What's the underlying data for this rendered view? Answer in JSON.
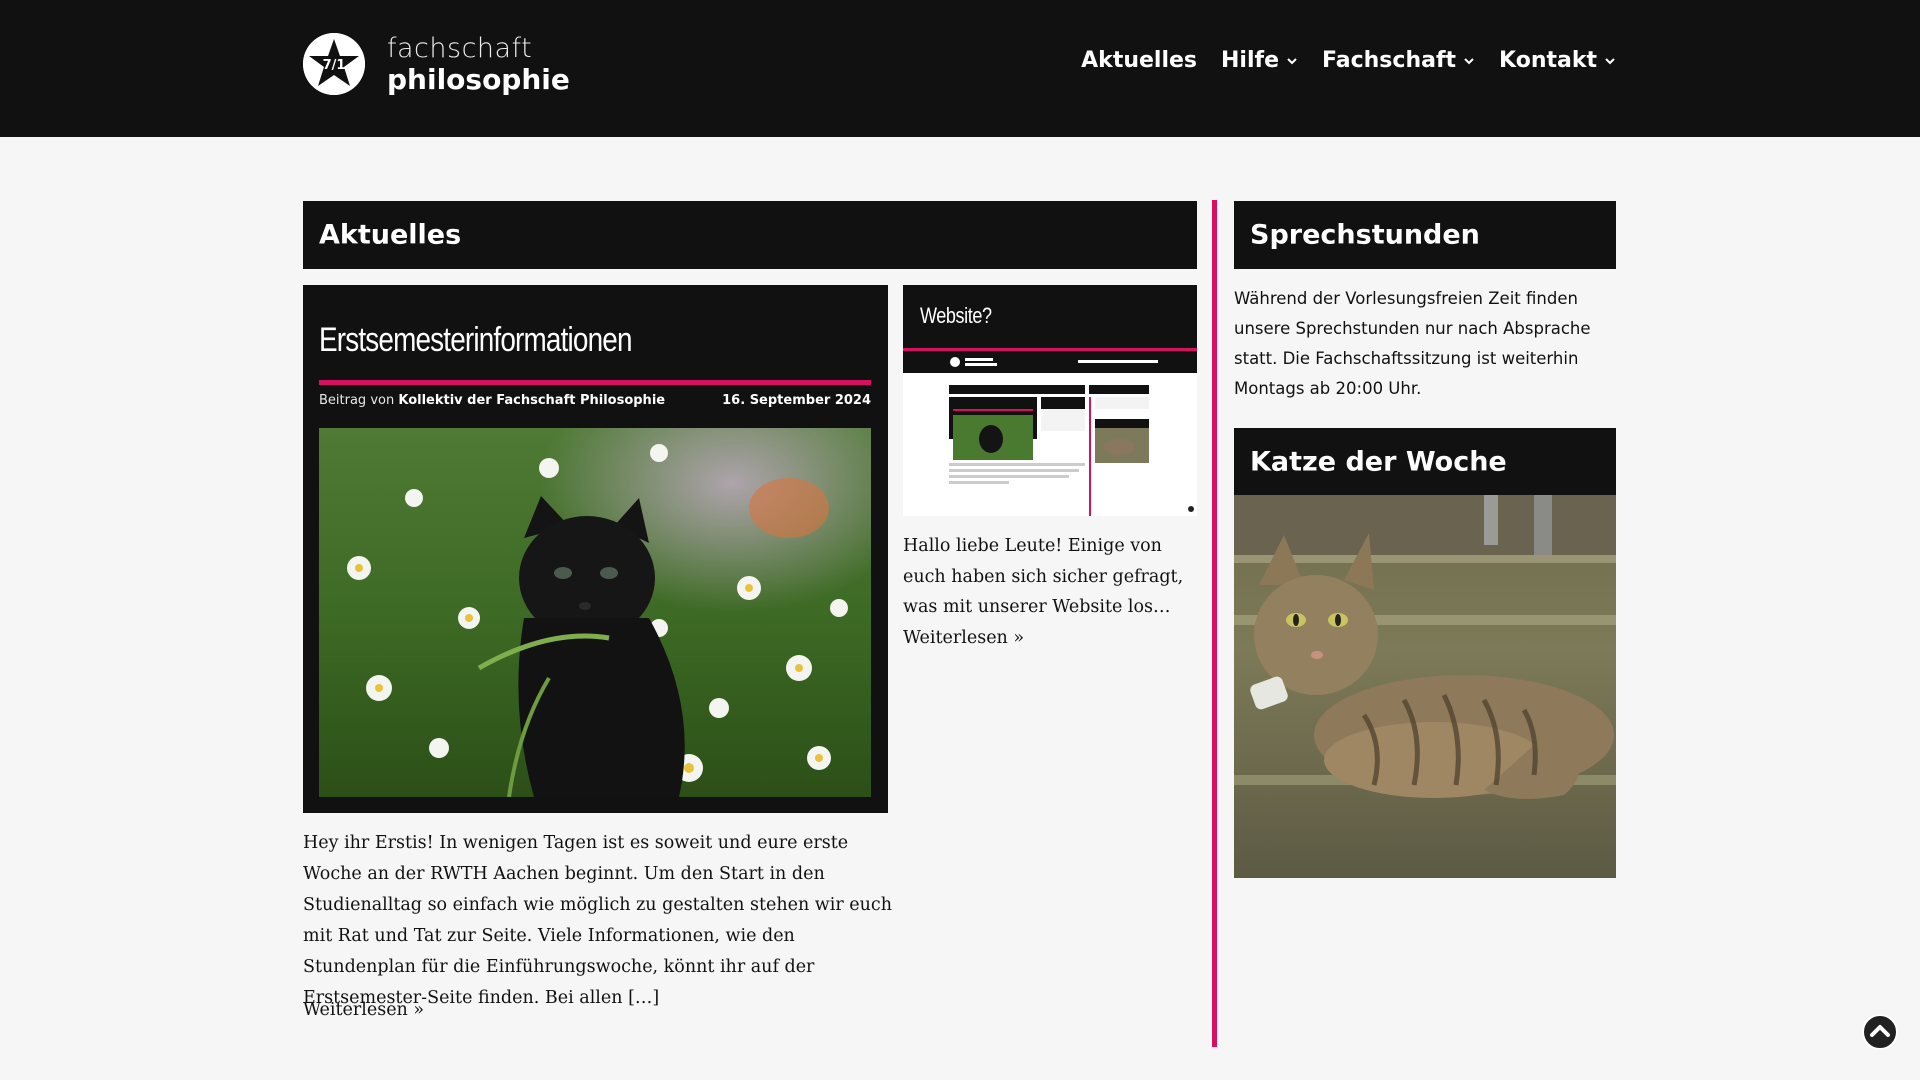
{
  "header": {
    "logo_top": "fachschaft",
    "logo_bottom": "philosophie",
    "logo_mark": "7/1",
    "nav": [
      {
        "label": "Aktuelles",
        "has_dropdown": false
      },
      {
        "label": "Hilfe",
        "has_dropdown": true
      },
      {
        "label": "Fachschaft",
        "has_dropdown": true
      },
      {
        "label": "Kontakt",
        "has_dropdown": true
      }
    ]
  },
  "main": {
    "section_title": "Aktuelles",
    "featured_post": {
      "title": "Erstsemesterinformationen",
      "by_prefix": "Beitrag von",
      "author": "Kollektiv der Fachschaft Philosophie",
      "date": "16. September 2024",
      "excerpt": "Hey ihr Erstis! In wenigen Tagen ist es soweit und eure erste Woche an der RWTH Aachen beginnt. Um den Start in den Studienalltag so einfach wie möglich zu gestalten stehen wir euch mit Rat und Tat zur Seite. Viele Informationen, wie den Stundenplan für die Einführungswoche, könnt ihr auf der Erstsemester-Seite finden. Bei allen […]",
      "read_more": "Weiterlesen »"
    },
    "second_post": {
      "title": "Website?",
      "excerpt": "Hallo liebe Leute! Einige von euch haben sich sicher gefragt, was mit unserer Website los… Weiterlesen »"
    }
  },
  "sidebar": {
    "office_hours_title": "Sprechstunden",
    "office_hours_text": "Während der Vorlesungsfreien Zeit finden unsere Sprechstunden nur nach Absprache statt. Die Fachschaftssitzung ist weiterhin Montags ab 20:00 Uhr.",
    "cat_title": "Katze der Woche"
  },
  "colors": {
    "accent": "#d6115f",
    "header_bg": "#111111",
    "page_bg": "#f6f6f6"
  },
  "icons": {
    "dropdown": "chevron-down-icon",
    "scroll_top": "chevron-up-icon",
    "logo": "star-logo-icon"
  }
}
